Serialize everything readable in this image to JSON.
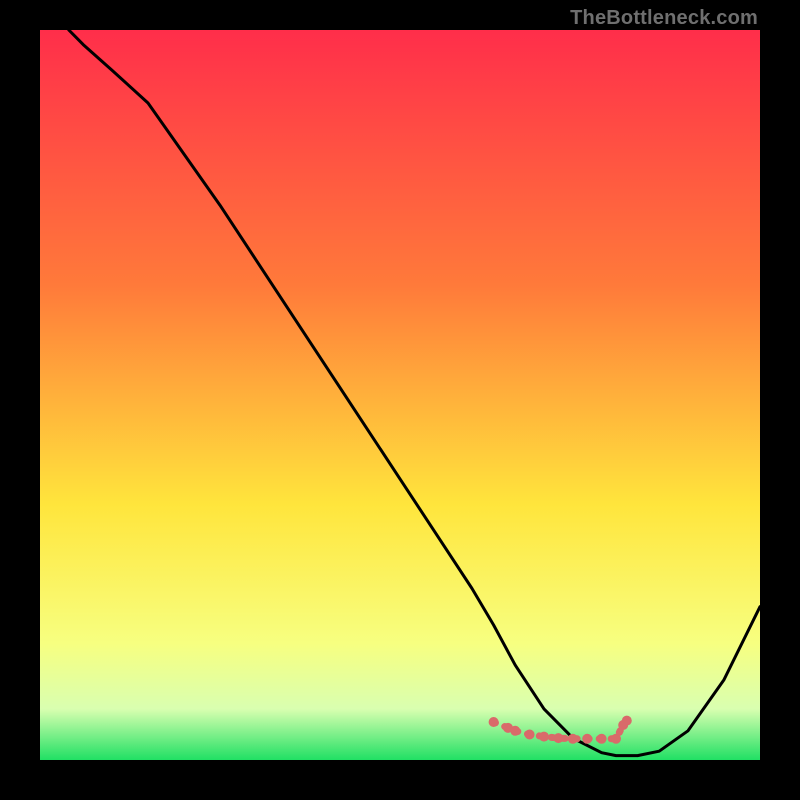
{
  "watermark": "TheBottleneck.com",
  "colors": {
    "top": "#ff2e4a",
    "mid1": "#ff7a3a",
    "mid2": "#ffe53c",
    "low1": "#f7ff80",
    "low2": "#d9ffb0",
    "bottom": "#20e064",
    "curve": "#000000",
    "marker": "#d96a6a",
    "frame": "#000000"
  },
  "chart_data": {
    "type": "line",
    "title": "",
    "xlabel": "",
    "ylabel": "",
    "xlim": [
      0,
      100
    ],
    "ylim": [
      0,
      100
    ],
    "series": [
      {
        "name": "bottleneck-curve",
        "x": [
          4,
          6,
          10,
          15,
          20,
          25,
          30,
          35,
          40,
          45,
          50,
          55,
          60,
          63,
          66,
          70,
          74,
          78,
          80,
          83,
          86,
          90,
          95,
          100
        ],
        "y": [
          100,
          98,
          94.5,
          90,
          83,
          76,
          68.5,
          61,
          53.5,
          46,
          38.5,
          31,
          23.5,
          18.5,
          13,
          7,
          3,
          1,
          0.6,
          0.6,
          1.2,
          4,
          11,
          21
        ]
      }
    ],
    "markers": {
      "name": "optimal-band",
      "x": [
        63,
        65,
        66,
        68,
        70,
        72,
        74,
        76,
        78,
        80,
        81,
        81.5
      ],
      "y": [
        5.2,
        4.4,
        4.0,
        3.5,
        3.2,
        3.0,
        2.9,
        2.9,
        2.9,
        2.9,
        4.8,
        5.4
      ]
    }
  }
}
